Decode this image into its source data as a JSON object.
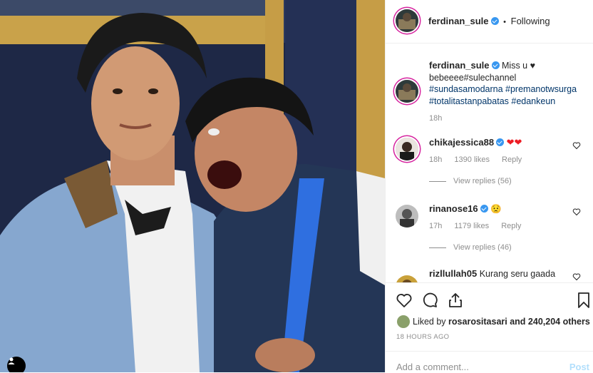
{
  "post": {
    "author": "ferdinan_sule",
    "follow_status": "Following",
    "caption_text": "Miss u ♥",
    "caption_tags_line1": "bebeeee#sulechannel",
    "caption_tags_line2": "#sundasamodarna #premanotwsurga",
    "caption_tags_line3": "#totalitastanpabatas #edankeun",
    "caption_time": "18h"
  },
  "comments": [
    {
      "user": "chikajessica88",
      "text": "❤❤",
      "time": "18h",
      "likes": "1390 likes",
      "reply": "Reply",
      "view_replies": "View replies (56)"
    },
    {
      "user": "rinanose16",
      "text": "😟",
      "time": "17h",
      "likes": "1179 likes",
      "reply": "Reply",
      "view_replies": "View replies (46)"
    },
    {
      "user": "rizllullah05",
      "text": "Kurang seru gaada"
    }
  ],
  "engagement": {
    "liked_by_prefix": "Liked by",
    "liked_by_user": "rosarositasari",
    "liked_by_suffix": "and 240,204 others",
    "posted": "18 HOURS AGO"
  },
  "comment_box": {
    "placeholder": "Add a comment...",
    "post_label": "Post"
  },
  "icons": [
    "heart-icon",
    "comment-icon",
    "share-icon",
    "bookmark-icon",
    "user-tag-icon",
    "verified-badge-icon"
  ],
  "colors": {
    "verified": "#3897f0",
    "hashtag": "#003569",
    "muted": "#8e8e8e",
    "post_disabled": "#b2dffc"
  }
}
